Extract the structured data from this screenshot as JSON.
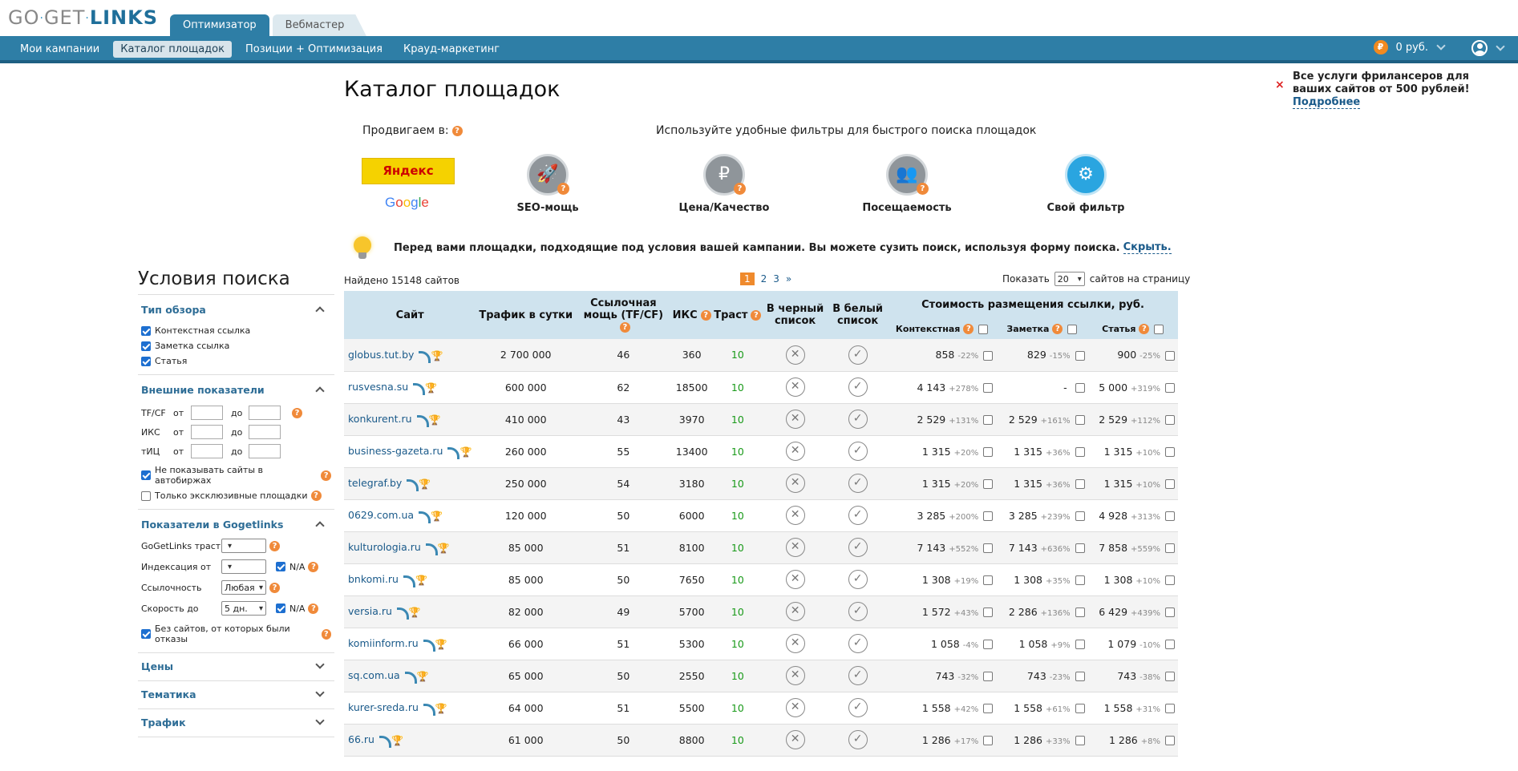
{
  "logo": {
    "part1": "GO",
    "part2": "GET",
    "part3": "LINKS"
  },
  "tabs": [
    {
      "label": "Оптимизатор"
    },
    {
      "label": "Вебмастер"
    }
  ],
  "nav": [
    {
      "label": "Мои кампании"
    },
    {
      "label": "Каталог площадок"
    },
    {
      "label": "Позиции + Оптимизация"
    },
    {
      "label": "Крауд-маркетинг"
    }
  ],
  "balance": {
    "currency_symbol": "₽",
    "amount": "0 руб."
  },
  "promo": {
    "text": "Все услуги фрилансеров для ваших сайтов от 500 рублей!",
    "link": "Подробнее",
    "close": "×"
  },
  "page_title": "Каталог площадок",
  "promote_label": "Продвигаем в:",
  "filters_hint": "Используйте удобные фильтры для быстрого поиска площадок",
  "yandex": "Яндекс",
  "google": [
    "G",
    "o",
    "o",
    "g",
    "l",
    "e"
  ],
  "filters": [
    {
      "label": "SEO-мощь",
      "icon": "rocket-icon",
      "glyph": "🚀"
    },
    {
      "label": "Цена/Качество",
      "icon": "piggy-bank-icon",
      "glyph": "₽"
    },
    {
      "label": "Посещаемость",
      "icon": "users-icon",
      "glyph": "👥"
    },
    {
      "label": "Свой фильтр",
      "icon": "gears-icon",
      "glyph": "⚙"
    }
  ],
  "notice": {
    "text": "Перед вами площадки, подходящие под условия вашей кампании. Вы можете сузить поиск, используя форму поиска.",
    "link": "Скрыть."
  },
  "sidebar": {
    "title": "Условия поиска",
    "review_type": {
      "label": "Тип обзора",
      "options": [
        "Контекстная ссылка",
        "Заметка ссылка",
        "Статья"
      ]
    },
    "external": {
      "label": "Внешние показатели",
      "from": "от",
      "to": "до",
      "rows": [
        "TF/CF",
        "ИКС",
        "тИЦ"
      ],
      "hide_auto": "Не показывать сайты в автобиржах",
      "exclusive": "Только эксклюзивные площадки"
    },
    "ggl": {
      "label": "Показатели в Gogetlinks",
      "trust": "GoGetLinks траст",
      "index": "Индексация от",
      "na": "N/A",
      "links": "Ссылочность",
      "links_value": "Любая",
      "speed": "Скорость до",
      "speed_value": "5 дн.",
      "no_refusals": "Без сайтов, от которых были отказы"
    },
    "closed": [
      "Цены",
      "Тематика",
      "Трафик"
    ]
  },
  "found": "Найдено 15148 сайтов",
  "pager": [
    "1",
    "2",
    "3",
    "»"
  ],
  "perpage": {
    "label": "Показать",
    "value": "20",
    "suffix": "сайтов на страницу"
  },
  "table": {
    "headers": {
      "site": "Сайт",
      "traffic": "Трафик в сутки",
      "link_power": "Ссылочная мощь (TF/CF)",
      "iks": "ИКС",
      "trust": "Траст",
      "black": "В черный список",
      "white": "В белый список",
      "cost": "Стоимость размещения ссылки, руб.",
      "context": "Контекстная",
      "note": "Заметка",
      "article": "Статья"
    },
    "rows": [
      {
        "site": "globus.tut.by",
        "traffic": "2 700 000",
        "power": "46",
        "iks": "360",
        "trust": "10",
        "c": "858",
        "cp": "-22%",
        "n": "829",
        "np": "-15%",
        "a": "900",
        "ap": "-25%"
      },
      {
        "site": "rusvesna.su",
        "traffic": "600 000",
        "power": "62",
        "iks": "18500",
        "trust": "10",
        "c": "4 143",
        "cp": "+278%",
        "n": "-",
        "np": "",
        "a": "5 000",
        "ap": "+319%"
      },
      {
        "site": "konkurent.ru",
        "traffic": "410 000",
        "power": "43",
        "iks": "3970",
        "trust": "10",
        "c": "2 529",
        "cp": "+131%",
        "n": "2 529",
        "np": "+161%",
        "a": "2 529",
        "ap": "+112%"
      },
      {
        "site": "business-gazeta.ru",
        "traffic": "260 000",
        "power": "55",
        "iks": "13400",
        "trust": "10",
        "c": "1 315",
        "cp": "+20%",
        "n": "1 315",
        "np": "+36%",
        "a": "1 315",
        "ap": "+10%"
      },
      {
        "site": "telegraf.by",
        "traffic": "250 000",
        "power": "54",
        "iks": "3180",
        "trust": "10",
        "c": "1 315",
        "cp": "+20%",
        "n": "1 315",
        "np": "+36%",
        "a": "1 315",
        "ap": "+10%"
      },
      {
        "site": "0629.com.ua",
        "traffic": "120 000",
        "power": "50",
        "iks": "6000",
        "trust": "10",
        "c": "3 285",
        "cp": "+200%",
        "n": "3 285",
        "np": "+239%",
        "a": "4 928",
        "ap": "+313%"
      },
      {
        "site": "kulturologia.ru",
        "traffic": "85 000",
        "power": "51",
        "iks": "8100",
        "trust": "10",
        "c": "7 143",
        "cp": "+552%",
        "n": "7 143",
        "np": "+636%",
        "a": "7 858",
        "ap": "+559%"
      },
      {
        "site": "bnkomi.ru",
        "traffic": "85 000",
        "power": "50",
        "iks": "7650",
        "trust": "10",
        "c": "1 308",
        "cp": "+19%",
        "n": "1 308",
        "np": "+35%",
        "a": "1 308",
        "ap": "+10%"
      },
      {
        "site": "versia.ru",
        "traffic": "82 000",
        "power": "49",
        "iks": "5700",
        "trust": "10",
        "c": "1 572",
        "cp": "+43%",
        "n": "2 286",
        "np": "+136%",
        "a": "6 429",
        "ap": "+439%"
      },
      {
        "site": "komiinform.ru",
        "traffic": "66 000",
        "power": "51",
        "iks": "5300",
        "trust": "10",
        "c": "1 058",
        "cp": "-4%",
        "n": "1 058",
        "np": "+9%",
        "a": "1 079",
        "ap": "-10%"
      },
      {
        "site": "sq.com.ua",
        "traffic": "65 000",
        "power": "50",
        "iks": "2550",
        "trust": "10",
        "c": "743",
        "cp": "-32%",
        "n": "743",
        "np": "-23%",
        "a": "743",
        "ap": "-38%"
      },
      {
        "site": "kurer-sreda.ru",
        "traffic": "64 000",
        "power": "51",
        "iks": "5500",
        "trust": "10",
        "c": "1 558",
        "cp": "+42%",
        "n": "1 558",
        "np": "+61%",
        "a": "1 558",
        "ap": "+31%"
      },
      {
        "site": "66.ru",
        "traffic": "61 000",
        "power": "50",
        "iks": "8800",
        "trust": "10",
        "c": "1 286",
        "cp": "+17%",
        "n": "1 286",
        "np": "+33%",
        "a": "1 286",
        "ap": "+8%"
      }
    ]
  }
}
